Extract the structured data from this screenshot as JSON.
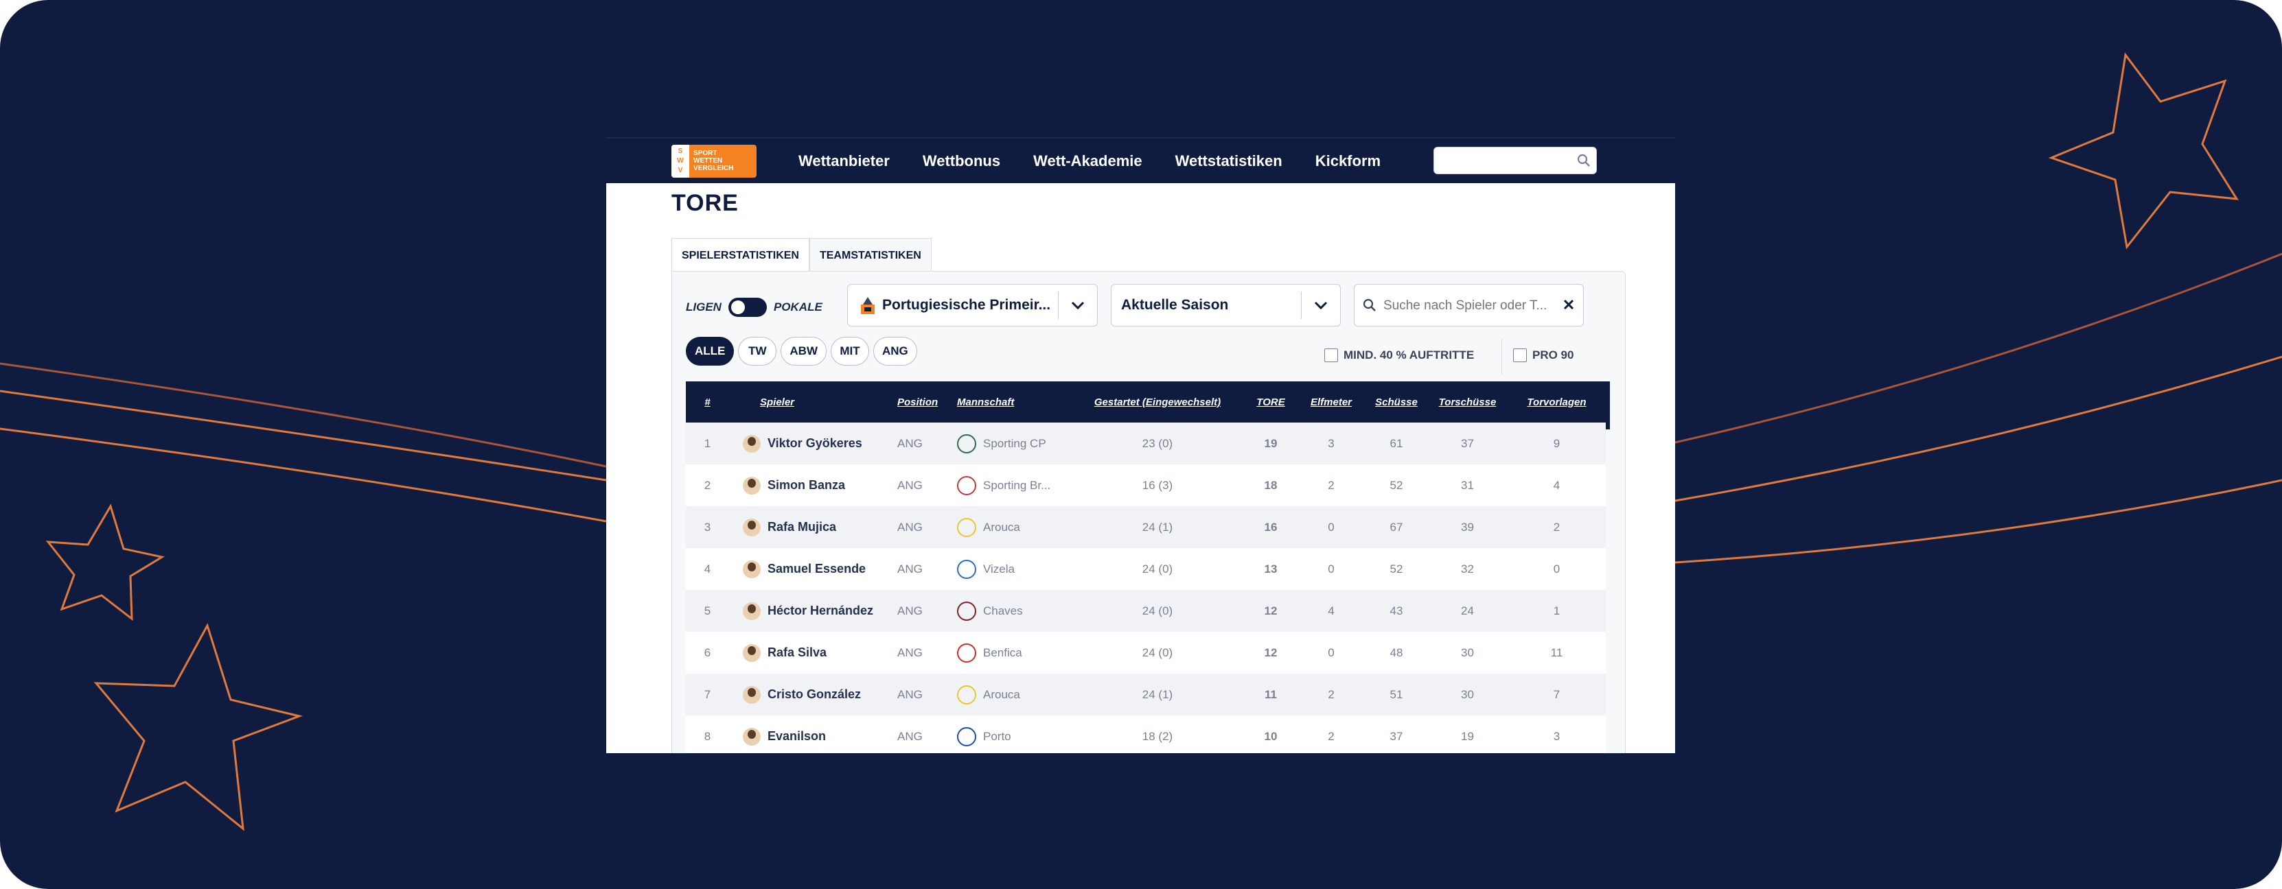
{
  "nav": {
    "logo_letters": [
      "S",
      "W",
      "V"
    ],
    "logo_text": [
      "SPORT",
      "WETTEN",
      "VERGLEICH"
    ],
    "links": [
      "Wettanbieter",
      "Wettbonus",
      "Wett-Akademie",
      "Wettstatistiken",
      "Kickform"
    ],
    "search_placeholder": ""
  },
  "page": {
    "title": "TORE",
    "tabs": [
      "SPIELERSTATISTIKEN",
      "TEAMSTATISTIKEN"
    ]
  },
  "filters": {
    "toggle_left": "LIGEN",
    "toggle_right": "POKALE",
    "league": "Portugiesische Primeir...",
    "season": "Aktuelle Saison",
    "search_placeholder": "Suche nach Spieler oder T...",
    "positions": [
      "ALLE",
      "TW",
      "ABW",
      "MIT",
      "ANG"
    ],
    "checkbox_min": "MIND. 40 % AUFTRITTE",
    "checkbox_per90": "PRO 90"
  },
  "table": {
    "headers": [
      "#",
      "Spieler",
      "Position",
      "Mannschaft",
      "Gestartet (Eingewechselt)",
      "TORE",
      "Elfmeter",
      "Schüsse",
      "Torschüsse",
      "Torvorlagen"
    ],
    "rows": [
      {
        "rank": "1",
        "player": "Viktor Gyökeres",
        "position": "ANG",
        "team": "Sporting CP",
        "started": "23 (0)",
        "goals": "19",
        "penalties": "3",
        "shots": "61",
        "on_target": "37",
        "assists": "9"
      },
      {
        "rank": "2",
        "player": "Simon Banza",
        "position": "ANG",
        "team": "Sporting Br...",
        "started": "16 (3)",
        "goals": "18",
        "penalties": "2",
        "shots": "52",
        "on_target": "31",
        "assists": "4"
      },
      {
        "rank": "3",
        "player": "Rafa Mujica",
        "position": "ANG",
        "team": "Arouca",
        "started": "24 (1)",
        "goals": "16",
        "penalties": "0",
        "shots": "67",
        "on_target": "39",
        "assists": "2"
      },
      {
        "rank": "4",
        "player": "Samuel Essende",
        "position": "ANG",
        "team": "Vizela",
        "started": "24 (0)",
        "goals": "13",
        "penalties": "0",
        "shots": "52",
        "on_target": "32",
        "assists": "0"
      },
      {
        "rank": "5",
        "player": "Héctor Hernández",
        "position": "ANG",
        "team": "Chaves",
        "started": "24 (0)",
        "goals": "12",
        "penalties": "4",
        "shots": "43",
        "on_target": "24",
        "assists": "1"
      },
      {
        "rank": "6",
        "player": "Rafa Silva",
        "position": "ANG",
        "team": "Benfica",
        "started": "24 (0)",
        "goals": "12",
        "penalties": "0",
        "shots": "48",
        "on_target": "30",
        "assists": "11"
      },
      {
        "rank": "7",
        "player": "Cristo González",
        "position": "ANG",
        "team": "Arouca",
        "started": "24 (1)",
        "goals": "11",
        "penalties": "2",
        "shots": "51",
        "on_target": "30",
        "assists": "7"
      },
      {
        "rank": "8",
        "player": "Evanilson",
        "position": "ANG",
        "team": "Porto",
        "started": "18 (2)",
        "goals": "10",
        "penalties": "2",
        "shots": "37",
        "on_target": "19",
        "assists": "3"
      }
    ]
  },
  "colors": {
    "navy": "#0f1c3f",
    "orange": "#f58220",
    "decor_line": "#e07a3c"
  }
}
